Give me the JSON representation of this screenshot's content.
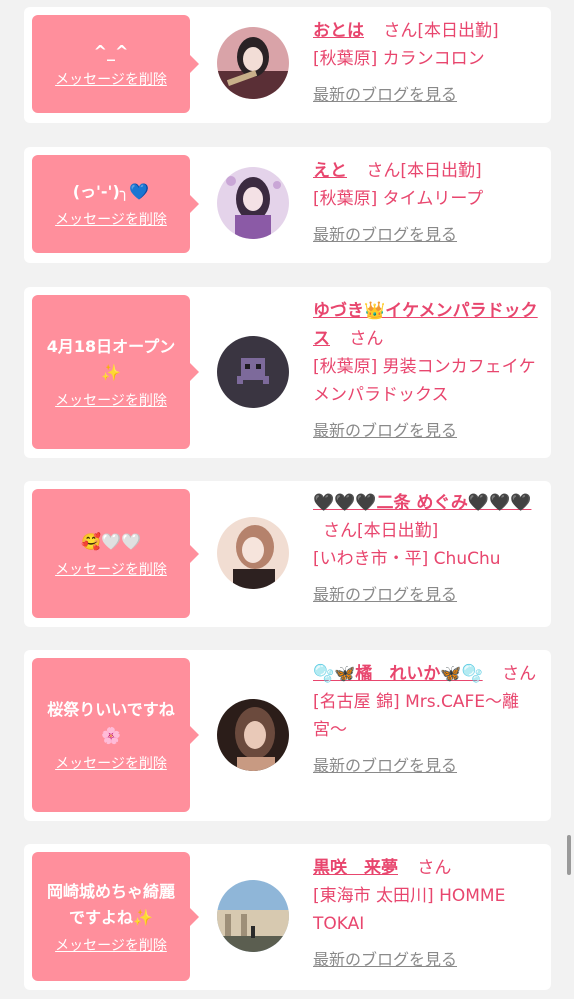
{
  "common": {
    "delete_label": "メッセージを削除",
    "blog_label": "最新のブログを見る",
    "san": "さん"
  },
  "cards": [
    {
      "message": "^_^",
      "name": "おとは",
      "status": "[本日出勤]",
      "shop": "[秋葉原] カランコロン",
      "avatar_colors": [
        "#2a2225",
        "#d9a3a8",
        "#5a2f36"
      ]
    },
    {
      "message": "(っ'-')╮💙",
      "name": "えと",
      "status": "[本日出勤]",
      "shop": "[秋葉原] タイムリープ",
      "avatar_colors": [
        "#e4d3ea",
        "#8b5aa6",
        "#3b2a40"
      ]
    },
    {
      "message": "4月18日オープン✨",
      "name": "ゆづき👑イケメンパラドックス",
      "status": "",
      "shop": "[秋葉原] 男装コンカフェイケメンパラドックス",
      "avatar_colors": [
        "#3a3541",
        "#7d6a9b",
        "#1e1b22"
      ]
    },
    {
      "message": "🥰🤍🤍",
      "name": "🖤🖤🖤二条 めぐみ🖤🖤🖤",
      "status": "[本日出勤]",
      "shop": "[いわき市・平] ChuChu",
      "avatar_colors": [
        "#f1ddd2",
        "#b5826c",
        "#2d2120"
      ]
    },
    {
      "message": "桜祭りいいですね🌸",
      "name": "🫧🦋橘　れいか🦋🫧",
      "status": "",
      "shop": "[名古屋 錦] Mrs.CAFE〜離宮〜",
      "avatar_colors": [
        "#6b4a3d",
        "#c89a82",
        "#2b1d19"
      ]
    },
    {
      "message": "岡崎城めちゃ綺麗ですよね✨",
      "name": "黒咲　来夢",
      "status": "",
      "shop": "[東海市 太田川] HOMME TOKAI",
      "avatar_colors": [
        "#8fb6d8",
        "#d7c9b0",
        "#5b5e50"
      ]
    }
  ]
}
